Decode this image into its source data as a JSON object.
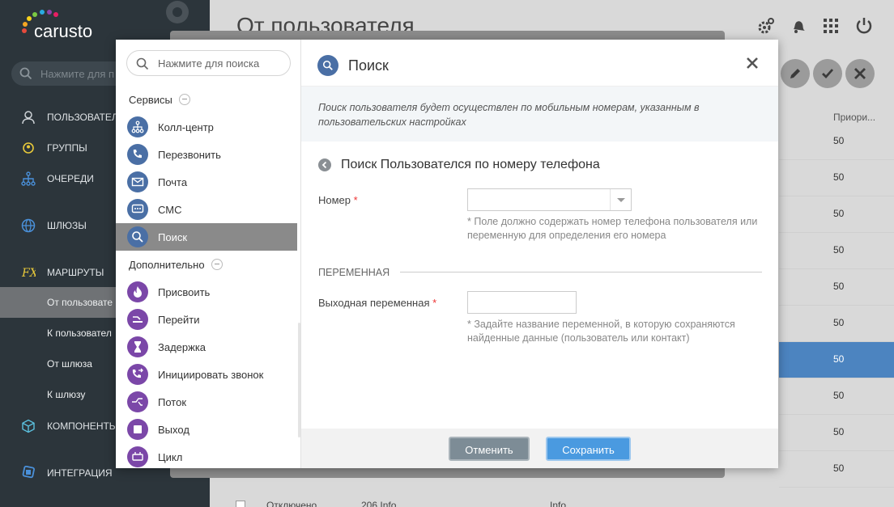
{
  "app": {
    "logo_text": "carusto"
  },
  "sidebar": {
    "search_placeholder": "Нажмите для п",
    "items": [
      {
        "label": "Пользовател",
        "icon": "user-icon"
      },
      {
        "label": "Группы",
        "icon": "users-icon"
      },
      {
        "label": "Очереди",
        "icon": "sitemap-icon"
      },
      {
        "label": "Шлюзы",
        "icon": "globe-icon"
      },
      {
        "label": "Маршруты",
        "icon": "function-icon"
      },
      {
        "label": "Компоненты",
        "icon": "cube-icon"
      },
      {
        "label": "Интеграция",
        "icon": "integration-icon"
      }
    ],
    "sub_items": [
      {
        "label": "От пользовате"
      },
      {
        "label": "К пользовател"
      },
      {
        "label": "От шлюза"
      },
      {
        "label": "К шлюзу"
      }
    ]
  },
  "page": {
    "title": "От пользователя"
  },
  "table": {
    "column_header": "Приори...",
    "rows": [
      "50",
      "50",
      "50",
      "50",
      "50",
      "50",
      "50",
      "50",
      "50",
      "50"
    ],
    "bottom_row": {
      "status": "Отключено",
      "name": "206 Info",
      "ext": "Info"
    }
  },
  "dialog": {
    "search_placeholder": "Нажмите для поиска",
    "sections": [
      {
        "label": "Сервисы"
      },
      {
        "label": "Дополнительно"
      }
    ],
    "items": [
      {
        "label": "Колл-центр",
        "icon": "sitemap-icon"
      },
      {
        "label": "Перезвонить",
        "icon": "phone-icon"
      },
      {
        "label": "Почта",
        "icon": "mail-icon"
      },
      {
        "label": "СМС",
        "icon": "sms-icon"
      },
      {
        "label": "Поиск",
        "icon": "search-icon"
      },
      {
        "label": "Присвоить",
        "icon": "flame-icon"
      },
      {
        "label": "Перейти",
        "icon": "goto-icon"
      },
      {
        "label": "Задержка",
        "icon": "hourglass-icon"
      },
      {
        "label": "Инициировать звонок",
        "icon": "phone-forward-icon"
      },
      {
        "label": "Поток",
        "icon": "flow-icon"
      },
      {
        "label": "Выход",
        "icon": "stop-icon"
      },
      {
        "label": "Цикл",
        "icon": "loop-icon"
      }
    ],
    "title": "Поиск",
    "info": "Поиск пользователя будет осуществлен по мобильным номерам, указанным в пользовательских настройках",
    "subtitle": "Поиск Пользователся по номеру телефона",
    "number_label": "Номер",
    "number_hint": "* Поле должно содержать номер телефона пользователя или переменную для определения его номера",
    "variable_section": "Переменная",
    "output_label": "Выходная переменная",
    "output_hint": "* Задайте название переменной, в которую сохраняются найденные данные (пользователь или контакт)",
    "required_mark": "*",
    "cancel_label": "Отменить",
    "save_label": "Сохранить"
  }
}
